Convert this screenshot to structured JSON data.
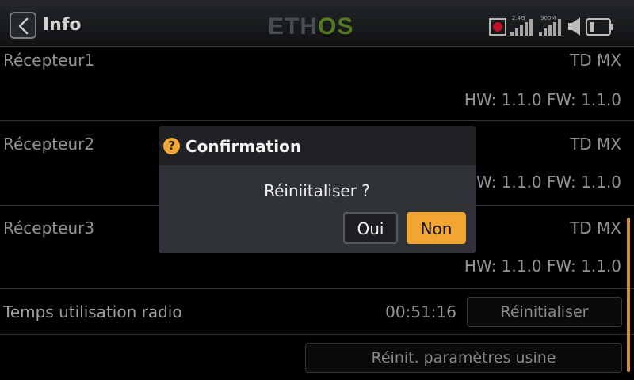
{
  "header": {
    "title": "Info",
    "logo": "ETHOS",
    "status": {
      "band_24": "2.4G",
      "band_900": "900M",
      "icons": [
        "record-icon",
        "rssi-24g-icon",
        "rssi-900m-icon",
        "speaker-icon",
        "battery-icon"
      ]
    }
  },
  "receivers": [
    {
      "name": "Récepteur1",
      "model": "TD MX",
      "versions": "HW: 1.1.0 FW: 1.1.0"
    },
    {
      "name": "Récepteur2",
      "model": "TD MX",
      "versions": "HW: 1.1.0 FW: 1.1.0"
    },
    {
      "name": "Récepteur3",
      "model": "TD MX",
      "versions": "HW: 1.1.0 FW: 1.1.0"
    }
  ],
  "radio_usage": {
    "label": "Temps utilisation radio",
    "time": "00:51:16",
    "reset_label": "Réinitialiser"
  },
  "factory_reset_label": "Réinit. paramètres usine",
  "dialog": {
    "title": "Confirmation",
    "message": "Réiniitaliser ?",
    "yes_label": "Oui",
    "no_label": "Non"
  },
  "colors": {
    "accent": "#f2a531",
    "logo_grey": "#55585c",
    "logo_green": "#5f8b25",
    "recording_red": "#e0102a",
    "background": "#000000",
    "dialog_bg": "#2f3237"
  }
}
